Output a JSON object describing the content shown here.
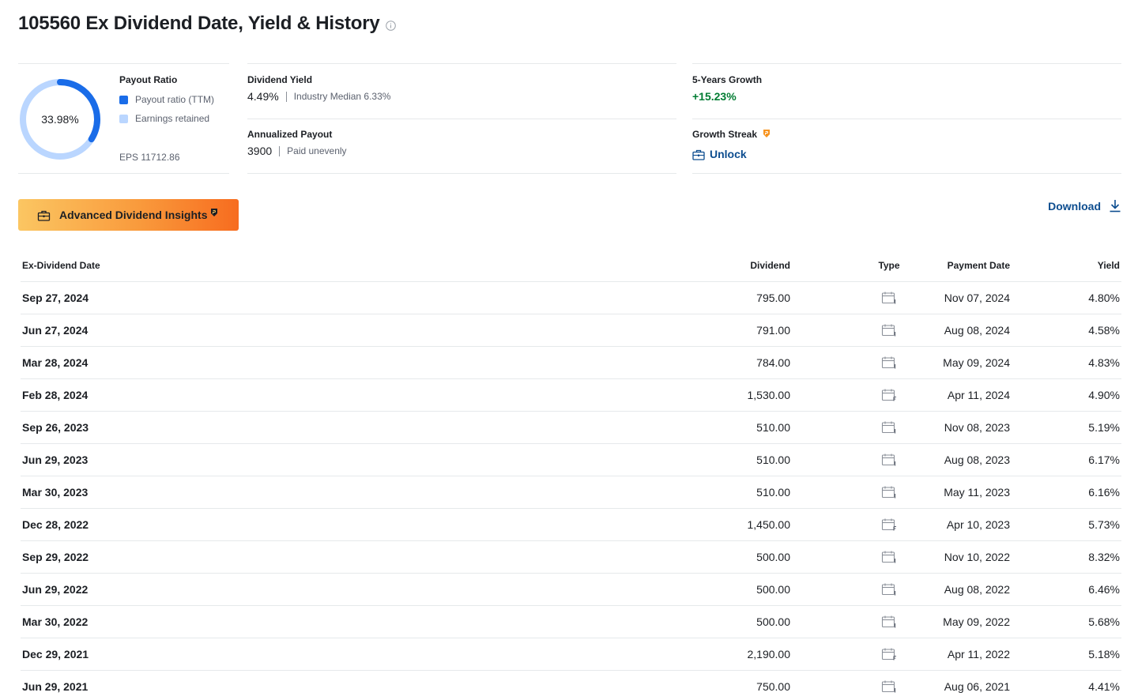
{
  "header": {
    "title": "105560 Ex Dividend Date, Yield & History"
  },
  "payout": {
    "heading": "Payout Ratio",
    "ratio_label": "33.98%",
    "ratio_fraction": 0.3398,
    "legend_payout": "Payout ratio (TTM)",
    "legend_retained": "Earnings retained",
    "eps": "EPS 11712.86",
    "colors": {
      "payout": "#1a6ce8",
      "retained": "#bad6ff"
    }
  },
  "yield": {
    "label": "Dividend Yield",
    "value": "4.49%",
    "sub": "Industry Median 6.33%"
  },
  "annualized": {
    "label": "Annualized Payout",
    "value": "3900",
    "sub": "Paid unevenly"
  },
  "growth5y": {
    "label": "5-Years Growth",
    "value": "+15.23%"
  },
  "streak": {
    "label": "Growth Streak",
    "unlock": "Unlock"
  },
  "actions": {
    "advanced": "Advanced Dividend Insights",
    "download": "Download"
  },
  "table": {
    "headers": {
      "date": "Ex-Dividend Date",
      "dividend": "Dividend",
      "type": "Type",
      "payment": "Payment Date",
      "yield": "Yield"
    },
    "rows": [
      {
        "date": "Sep 27, 2024",
        "dividend": "795.00",
        "type": "quarterly-calendar-icon",
        "payment": "Nov 07, 2024",
        "yield": "4.80%"
      },
      {
        "date": "Jun 27, 2024",
        "dividend": "791.00",
        "type": "quarterly-calendar-icon",
        "payment": "Aug 08, 2024",
        "yield": "4.58%"
      },
      {
        "date": "Mar 28, 2024",
        "dividend": "784.00",
        "type": "quarterly-calendar-icon",
        "payment": "May 09, 2024",
        "yield": "4.83%"
      },
      {
        "date": "Feb 28, 2024",
        "dividend": "1,530.00",
        "type": "final-calendar-icon",
        "payment": "Apr 11, 2024",
        "yield": "4.90%"
      },
      {
        "date": "Sep 26, 2023",
        "dividend": "510.00",
        "type": "quarterly-calendar-icon",
        "payment": "Nov 08, 2023",
        "yield": "5.19%"
      },
      {
        "date": "Jun 29, 2023",
        "dividend": "510.00",
        "type": "quarterly-calendar-icon",
        "payment": "Aug 08, 2023",
        "yield": "6.17%"
      },
      {
        "date": "Mar 30, 2023",
        "dividend": "510.00",
        "type": "quarterly-calendar-icon",
        "payment": "May 11, 2023",
        "yield": "6.16%"
      },
      {
        "date": "Dec 28, 2022",
        "dividend": "1,450.00",
        "type": "final-calendar-icon",
        "payment": "Apr 10, 2023",
        "yield": "5.73%"
      },
      {
        "date": "Sep 29, 2022",
        "dividend": "500.00",
        "type": "quarterly-calendar-icon",
        "payment": "Nov 10, 2022",
        "yield": "8.32%"
      },
      {
        "date": "Jun 29, 2022",
        "dividend": "500.00",
        "type": "quarterly-calendar-icon",
        "payment": "Aug 08, 2022",
        "yield": "6.46%"
      },
      {
        "date": "Mar 30, 2022",
        "dividend": "500.00",
        "type": "quarterly-calendar-icon",
        "payment": "May 09, 2022",
        "yield": "5.68%"
      },
      {
        "date": "Dec 29, 2021",
        "dividend": "2,190.00",
        "type": "final-calendar-icon",
        "payment": "Apr 11, 2022",
        "yield": "5.18%"
      },
      {
        "date": "Jun 29, 2021",
        "dividend": "750.00",
        "type": "quarterly-calendar-icon",
        "payment": "Aug 06, 2021",
        "yield": "4.41%"
      }
    ]
  },
  "colors": {
    "link": "#0d4d8f",
    "positive": "#007c32",
    "pro_badge": "#f7931e"
  }
}
